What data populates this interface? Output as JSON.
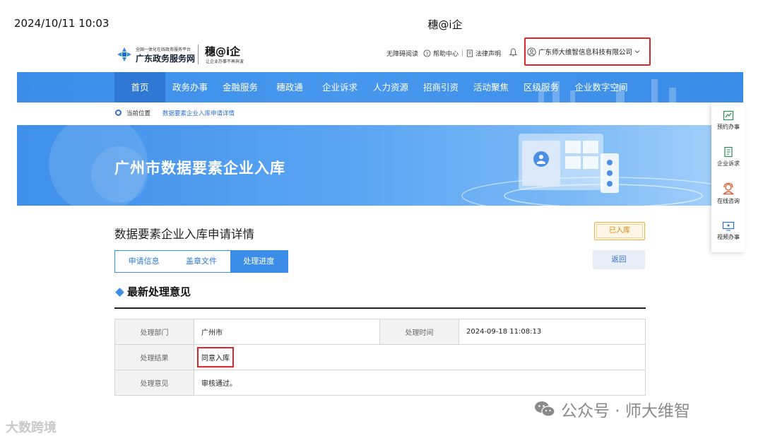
{
  "timestamp": "2024/10/11 10:03",
  "window_title": "穗@i企",
  "header": {
    "logo_small": "全国一体化在线政务服务平台",
    "logo_main": "广东政务服务网",
    "brand_main": "穗@i企",
    "brand_sub": "让企业办事不再奔波",
    "links": {
      "accessible": "无障碍阅读",
      "help": "帮助中心",
      "legal": "法律声明"
    },
    "company": "广东师大维智信息科技有限公司"
  },
  "nav": [
    "首页",
    "政务办事",
    "金融服务",
    "穗政通",
    "企业诉求",
    "人力资源",
    "招商引资",
    "活动聚焦",
    "区级服务",
    "企业数字空间"
  ],
  "breadcrumb": {
    "label": "当前位置",
    "path": "数据要素企业入库申请详情"
  },
  "banner_title": "广州市数据要素企业入库",
  "side": [
    "预约办事",
    "企业诉求",
    "在线咨询",
    "视频办事"
  ],
  "page_title": "数据要素企业入库申请详情",
  "status_badge": "已入库",
  "tabs": [
    "申请信息",
    "盖章文件",
    "处理进度"
  ],
  "back_label": "返回",
  "section_title": "最新处理意见",
  "table": {
    "dept_label": "处理部门",
    "dept": "广州市",
    "time_label": "处理时间",
    "time": "2024-09-18 11:08:13",
    "result_label": "处理结果",
    "result": "同意入库",
    "opinion_label": "处理意见",
    "opinion": "审核通过。"
  },
  "watermark_right": "公众号 · 师大维智",
  "watermark_left": "大数跨境",
  "colors": {
    "primary": "#3b8de8",
    "highlight": "#e0262b",
    "badge": "#d98700"
  }
}
